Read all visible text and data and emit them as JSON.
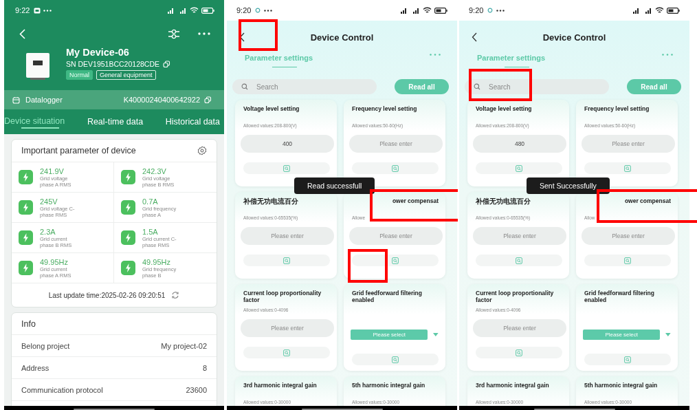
{
  "screens": [
    {
      "kind": "device_detail",
      "status_time": "9:22",
      "device": {
        "name": "My Device-06",
        "sn": "SN DEV1951BCC20128CDE",
        "badges": [
          {
            "label": "Normal",
            "kind": "filled"
          },
          {
            "label": "General equipment",
            "kind": "outline"
          }
        ]
      },
      "datalogger": {
        "label": "Datalogger",
        "value": "K40000240400642922"
      },
      "tabs": [
        {
          "label": "Device situation",
          "selected": true
        },
        {
          "label": "Real-time data",
          "selected": false
        },
        {
          "label": "Historical data",
          "selected": false
        }
      ],
      "param_card": {
        "title": "Important parameter of device",
        "metrics": [
          {
            "value": "241.9V",
            "label": "Grid voltage phase A RMS"
          },
          {
            "value": "242.3V",
            "label": "Grid voltage phase B RMS"
          },
          {
            "value": "245V",
            "label": "Grid voltage C-phase RMS"
          },
          {
            "value": "0.7A",
            "label": "Grid frequency phase A"
          },
          {
            "value": "2.3A",
            "label": "Grid current phase B RMS"
          },
          {
            "value": "1.5A",
            "label": "Grid current C-phase RMS"
          },
          {
            "value": "49.95Hz",
            "label": "Grid current phase A RMS"
          },
          {
            "value": "49.95Hz",
            "label": "Grid frequency phase B"
          }
        ],
        "last_update": "Last update time:2025-02-26 09:20:51"
      },
      "info": {
        "title": "Info",
        "rows": [
          {
            "label": "Belong project",
            "value": "My project-02"
          },
          {
            "label": "Address",
            "value": "8"
          },
          {
            "label": "Communication protocol",
            "value": "23600"
          }
        ]
      }
    },
    {
      "kind": "device_control",
      "status_time": "9:20",
      "title": "Device Control",
      "tab": {
        "label": "Parameter settings",
        "selected": true
      },
      "search": {
        "placeholder": "Search"
      },
      "read_all": "Read all",
      "toast": "Read successfull",
      "cards": [
        {
          "kind": "input",
          "title": "Voltage level setting",
          "allowed": "Allowed values:208-800(V)",
          "value": "400"
        },
        {
          "kind": "input",
          "title": "Frequency level setting",
          "allowed": "Allowed values:50-60(Hz)",
          "placeholder": "Please enter"
        },
        {
          "kind": "input",
          "title": "补偿无功电流百分",
          "allowed": "Allowed values:0-65535(%)",
          "placeholder": "Please enter"
        },
        {
          "kind": "input",
          "title": "ower compensat",
          "allowed": "Allowe",
          "placeholder": "Please enter"
        },
        {
          "kind": "input",
          "title": "Current loop proportionality factor",
          "allowed": "Allowed values:0-4096",
          "placeholder": "Please enter"
        },
        {
          "kind": "select",
          "title": "Grid feedforward filtering enabled",
          "placeholder": "Please select"
        },
        {
          "kind": "partial",
          "title": "3rd harmonic integral gain",
          "allowed": "Allowed values:0-30000"
        },
        {
          "kind": "partial",
          "title": "5th harmonic integral gain",
          "allowed": "Allowed values:0-30000"
        }
      ]
    },
    {
      "kind": "device_control",
      "status_time": "9:20",
      "title": "Device Control",
      "tab": {
        "label": "Parameter settings",
        "selected": true
      },
      "search": {
        "placeholder": "Search"
      },
      "read_all": "Read all",
      "toast": "Sent Successfully",
      "cards": [
        {
          "kind": "input",
          "title": "Voltage level setting",
          "allowed": "Allowed values:208-800(V)",
          "value": "480"
        },
        {
          "kind": "input",
          "title": "Frequency level setting",
          "allowed": "Allowed values:50-60(Hz)",
          "placeholder": "Please enter"
        },
        {
          "kind": "input",
          "title": "补偿无功电流百分",
          "allowed": "Allowed values:0-65535(%)",
          "placeholder": "Please enter"
        },
        {
          "kind": "input",
          "title": "ower compensat",
          "allowed": "Allow",
          "placeholder": "Please enter"
        },
        {
          "kind": "input",
          "title": "Current loop proportionality factor",
          "allowed": "Allowed values:0-4096",
          "placeholder": "Please enter"
        },
        {
          "kind": "select",
          "title": "Grid feedforward filtering enabled",
          "placeholder": "Please select"
        },
        {
          "kind": "partial",
          "title": "3rd harmonic integral gain",
          "allowed": "Allowed values:0-30000"
        },
        {
          "kind": "partial",
          "title": "5th harmonic integral gain",
          "allowed": "Allowed values:0-30000"
        }
      ]
    }
  ]
}
